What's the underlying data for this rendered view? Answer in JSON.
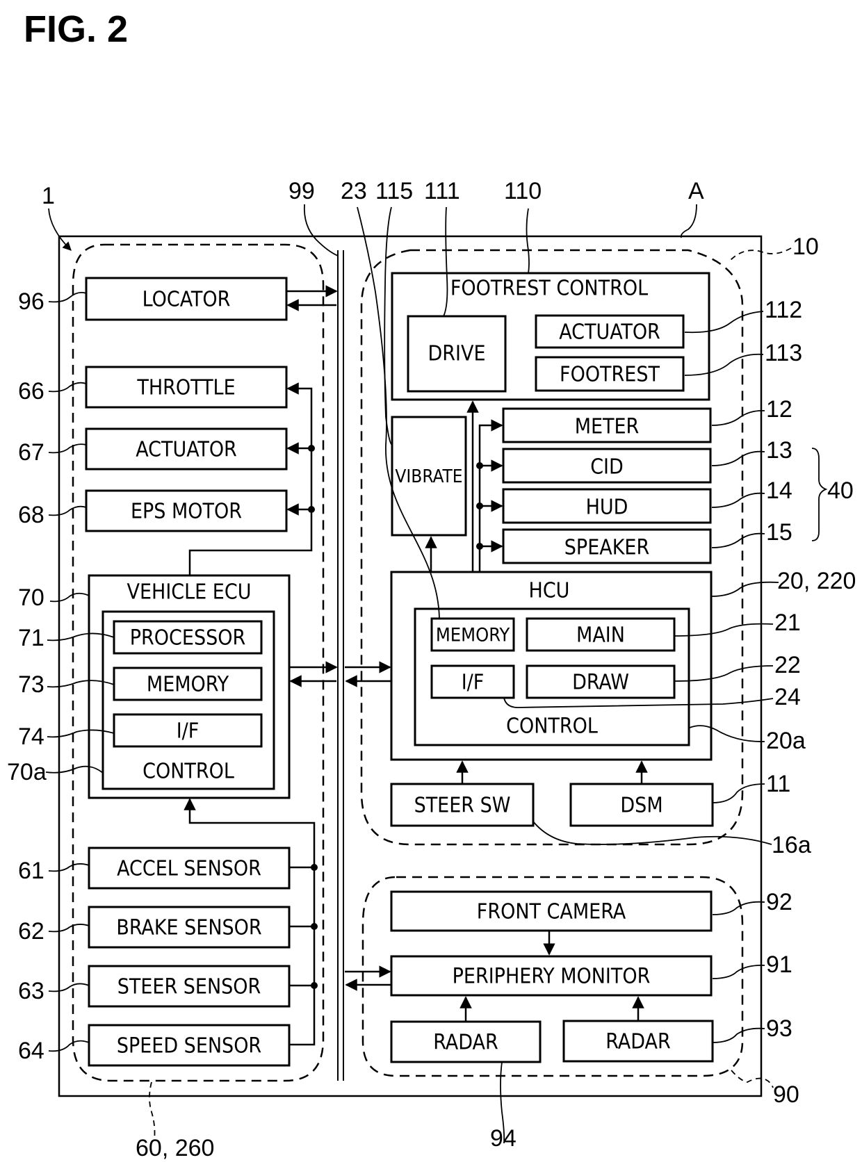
{
  "figure": {
    "title": "FIG. 2"
  },
  "refs": {
    "r1": "1",
    "r99": "99",
    "r23": "23",
    "r115": "115",
    "r111": "111",
    "r110": "110",
    "rA": "A",
    "r10": "10",
    "r96": "96",
    "r112": "112",
    "r113": "113",
    "r66": "66",
    "r12": "12",
    "r67": "67",
    "r13": "13",
    "r68": "68",
    "r14": "14",
    "r40": "40",
    "r15": "15",
    "r70": "70",
    "r20": "20, 220",
    "r71": "71",
    "r21": "21",
    "r73": "73",
    "r22": "22",
    "r24": "24",
    "r74": "74",
    "r20a": "20a",
    "r70a": "70a",
    "r11": "11",
    "r16a": "16a",
    "r61": "61",
    "r92": "92",
    "r62": "62",
    "r91": "91",
    "r63": "63",
    "r93": "93",
    "r64": "64",
    "r90": "90",
    "r60": "60, 260",
    "r94": "94"
  },
  "blocks": {
    "locator": "LOCATOR",
    "throttle": "THROTTLE",
    "actuator_left": "ACTUATOR",
    "eps_motor": "EPS MOTOR",
    "vehicle_ecu": "VEHICLE ECU",
    "processor": "PROCESSOR",
    "memory_left": "MEMORY",
    "if_left": "I/F",
    "control_left": "CONTROL",
    "accel_sensor": "ACCEL SENSOR",
    "brake_sensor": "BRAKE SENSOR",
    "steer_sensor": "STEER SENSOR",
    "speed_sensor": "SPEED SENSOR",
    "footrest_control": "FOOTREST CONTROL",
    "drive": "DRIVE",
    "actuator_right": "ACTUATOR",
    "footrest": "FOOTREST",
    "vibrate": "VIBRATE",
    "meter": "METER",
    "cid": "CID",
    "hud": "HUD",
    "speaker": "SPEAKER",
    "hcu": "HCU",
    "memory_right": "MEMORY",
    "main": "MAIN",
    "if_right": "I/F",
    "draw": "DRAW",
    "control_right": "CONTROL",
    "steer_sw": "STEER SW",
    "dsm": "DSM",
    "front_camera": "FRONT CAMERA",
    "periphery_monitor": "PERIPHERY MONITOR",
    "radar_left": "RADAR",
    "radar_right": "RADAR"
  }
}
